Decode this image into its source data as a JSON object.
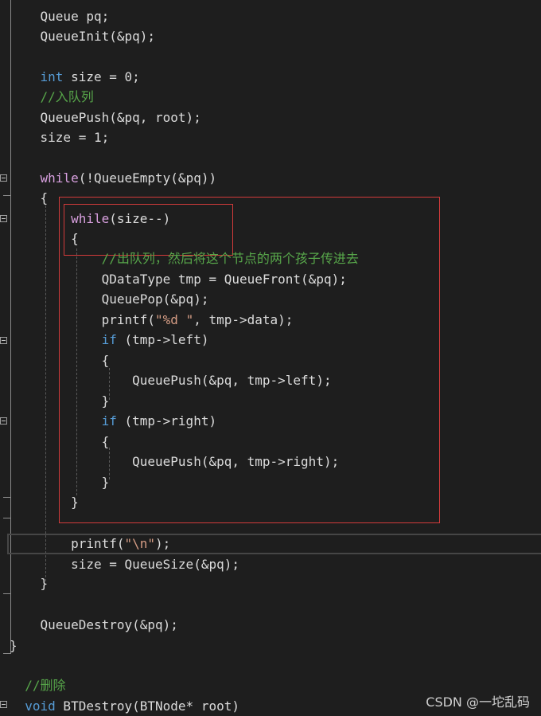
{
  "code_lines": [
    {
      "id": "l1",
      "parts": [
        [
          "",
          "    "
        ],
        [
          "p",
          "Queue pq;"
        ]
      ]
    },
    {
      "id": "l2",
      "parts": [
        [
          "",
          "    "
        ],
        [
          "p",
          "QueueInit(&pq);"
        ]
      ]
    },
    {
      "id": "l3",
      "parts": []
    },
    {
      "id": "l4",
      "parts": [
        [
          "",
          "    "
        ],
        [
          "kw",
          "int"
        ],
        [
          "p",
          " size = 0;"
        ]
      ]
    },
    {
      "id": "l5",
      "parts": [
        [
          "",
          "    "
        ],
        [
          "cm",
          "//入队列"
        ]
      ]
    },
    {
      "id": "l6",
      "parts": [
        [
          "",
          "    "
        ],
        [
          "p",
          "QueuePush(&pq, root);"
        ]
      ]
    },
    {
      "id": "l7",
      "parts": [
        [
          "",
          "    "
        ],
        [
          "p",
          "size = 1;"
        ]
      ]
    },
    {
      "id": "l8",
      "parts": []
    },
    {
      "id": "l9",
      "parts": [
        [
          "",
          "    "
        ],
        [
          "ctrl",
          "while"
        ],
        [
          "p",
          "(!QueueEmpty(&pq))"
        ]
      ]
    },
    {
      "id": "l10",
      "parts": [
        [
          "",
          "    "
        ],
        [
          "p",
          "{"
        ]
      ]
    },
    {
      "id": "l11",
      "parts": [
        [
          "",
          "        "
        ],
        [
          "ctrl",
          "while"
        ],
        [
          "p",
          "(size--)"
        ]
      ]
    },
    {
      "id": "l12",
      "parts": [
        [
          "",
          "        "
        ],
        [
          "p",
          "{"
        ]
      ]
    },
    {
      "id": "l13",
      "parts": [
        [
          "",
          "            "
        ],
        [
          "cm",
          "//出队列，然后将这个节点的两个孩子传进去"
        ]
      ]
    },
    {
      "id": "l14",
      "parts": [
        [
          "",
          "            "
        ],
        [
          "p",
          "QDataType tmp = QueueFront(&pq);"
        ]
      ]
    },
    {
      "id": "l15",
      "parts": [
        [
          "",
          "            "
        ],
        [
          "p",
          "QueuePop(&pq);"
        ]
      ]
    },
    {
      "id": "l16",
      "parts": [
        [
          "",
          "            "
        ],
        [
          "p",
          "printf("
        ],
        [
          "str",
          "\"%d \""
        ],
        [
          "p",
          ", tmp->data);"
        ]
      ]
    },
    {
      "id": "l17",
      "parts": [
        [
          "",
          "            "
        ],
        [
          "kw",
          "if"
        ],
        [
          "p",
          " (tmp->left)"
        ]
      ]
    },
    {
      "id": "l18",
      "parts": [
        [
          "",
          "            "
        ],
        [
          "p",
          "{"
        ]
      ]
    },
    {
      "id": "l19",
      "parts": [
        [
          "",
          "                "
        ],
        [
          "p",
          "QueuePush(&pq, tmp->left);"
        ]
      ]
    },
    {
      "id": "l20",
      "parts": [
        [
          "",
          "            "
        ],
        [
          "p",
          "}"
        ]
      ]
    },
    {
      "id": "l21",
      "parts": [
        [
          "",
          "            "
        ],
        [
          "kw",
          "if"
        ],
        [
          "p",
          " (tmp->right)"
        ]
      ]
    },
    {
      "id": "l22",
      "parts": [
        [
          "",
          "            "
        ],
        [
          "p",
          "{"
        ]
      ]
    },
    {
      "id": "l23",
      "parts": [
        [
          "",
          "                "
        ],
        [
          "p",
          "QueuePush(&pq, tmp->right);"
        ]
      ]
    },
    {
      "id": "l24",
      "parts": [
        [
          "",
          "            "
        ],
        [
          "p",
          "}"
        ]
      ]
    },
    {
      "id": "l25",
      "parts": [
        [
          "",
          "        "
        ],
        [
          "p",
          "}"
        ]
      ]
    },
    {
      "id": "l26",
      "parts": []
    },
    {
      "id": "l27",
      "parts": [
        [
          "",
          "        "
        ],
        [
          "p",
          "printf("
        ],
        [
          "str",
          "\"\\n\""
        ],
        [
          "p",
          ");"
        ]
      ]
    },
    {
      "id": "l28",
      "parts": [
        [
          "",
          "        "
        ],
        [
          "p",
          "size = QueueSize(&pq);"
        ]
      ]
    },
    {
      "id": "l29",
      "parts": [
        [
          "",
          "    "
        ],
        [
          "p",
          "}"
        ]
      ]
    },
    {
      "id": "l30",
      "parts": []
    },
    {
      "id": "l31",
      "parts": [
        [
          "",
          "    "
        ],
        [
          "p",
          "QueueDestroy(&pq);"
        ]
      ]
    },
    {
      "id": "l32",
      "parts": [
        [
          "",
          "}"
        ]
      ]
    },
    {
      "id": "l33",
      "parts": []
    },
    {
      "id": "l34",
      "parts": [
        [
          "",
          "  "
        ],
        [
          "cm",
          "//删除"
        ]
      ]
    },
    {
      "id": "l35",
      "parts": [
        [
          "",
          "  "
        ],
        [
          "kw",
          "void"
        ],
        [
          "p",
          " BTDestroy(BTNode* root)"
        ]
      ]
    }
  ],
  "watermark": "CSDN @一坨乱码",
  "colors": {
    "background": "#1e1e1e",
    "keyword": "#569cd6",
    "control": "#d8a0df",
    "comment": "#57a64a",
    "string": "#d69d85",
    "highlight_box": "#d23b3b"
  }
}
